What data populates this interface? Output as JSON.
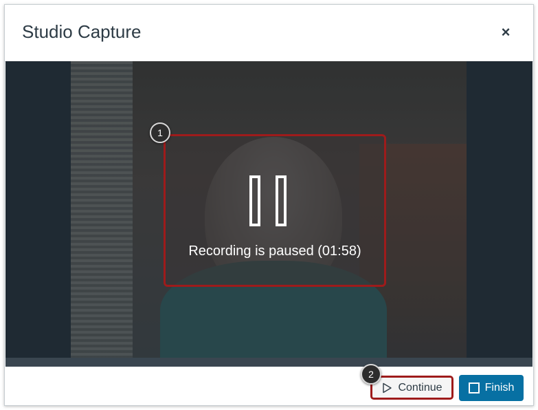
{
  "modal": {
    "title": "Studio Capture",
    "close_icon": "close-icon",
    "close_glyph": "×"
  },
  "recording": {
    "status_text": "Recording is paused (01:58)",
    "pause_icon": "pause-icon"
  },
  "callouts": {
    "first": "1",
    "second": "2"
  },
  "footer": {
    "continue_label": "Continue",
    "continue_icon": "play-icon",
    "finish_label": "Finish",
    "finish_icon": "stop-icon"
  },
  "colors": {
    "accent": "#0770a3",
    "highlight_border": "#9e1b1b",
    "title_text": "#2d3b45"
  }
}
